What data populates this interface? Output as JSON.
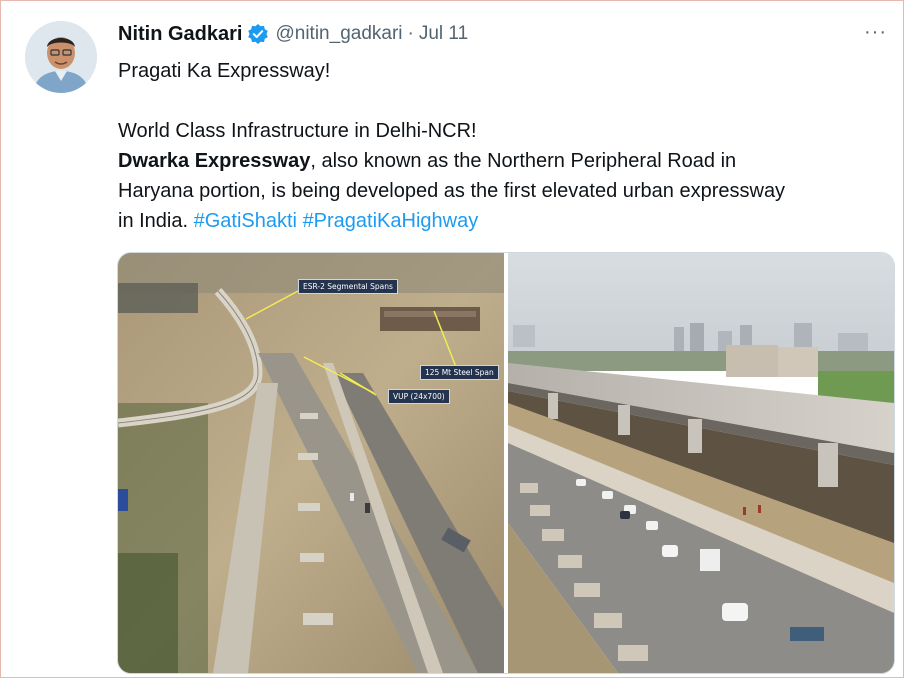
{
  "tweet": {
    "author_name": "Nitin Gadkari",
    "handle": "@nitin_gadkari",
    "separator": "·",
    "date": "Jul 11",
    "more_label": "···",
    "line1": "Pragati Ka Expressway!",
    "line2": "World Class Infrastructure in Delhi-NCR!",
    "bold_term": "Dwarka Expressway",
    "body_rest_1": ", also known as the Northern Peripheral Road in",
    "body_rest_2": "Haryana portion, is being developed as the first elevated urban expressway",
    "body_rest_3": "in India. ",
    "hashtags": [
      "#GatiShakti",
      "#PragatiKaHighway"
    ]
  },
  "photo_left_annotations": {
    "esr": "ESR-2 Segmental Spans",
    "steel": "125 Mt Steel Span",
    "vup": "VUP (24x700)"
  },
  "colors": {
    "link": "#1d9bf0",
    "verified": "#1d9bf0",
    "muted": "#536471",
    "label_bg": "#24344f"
  }
}
